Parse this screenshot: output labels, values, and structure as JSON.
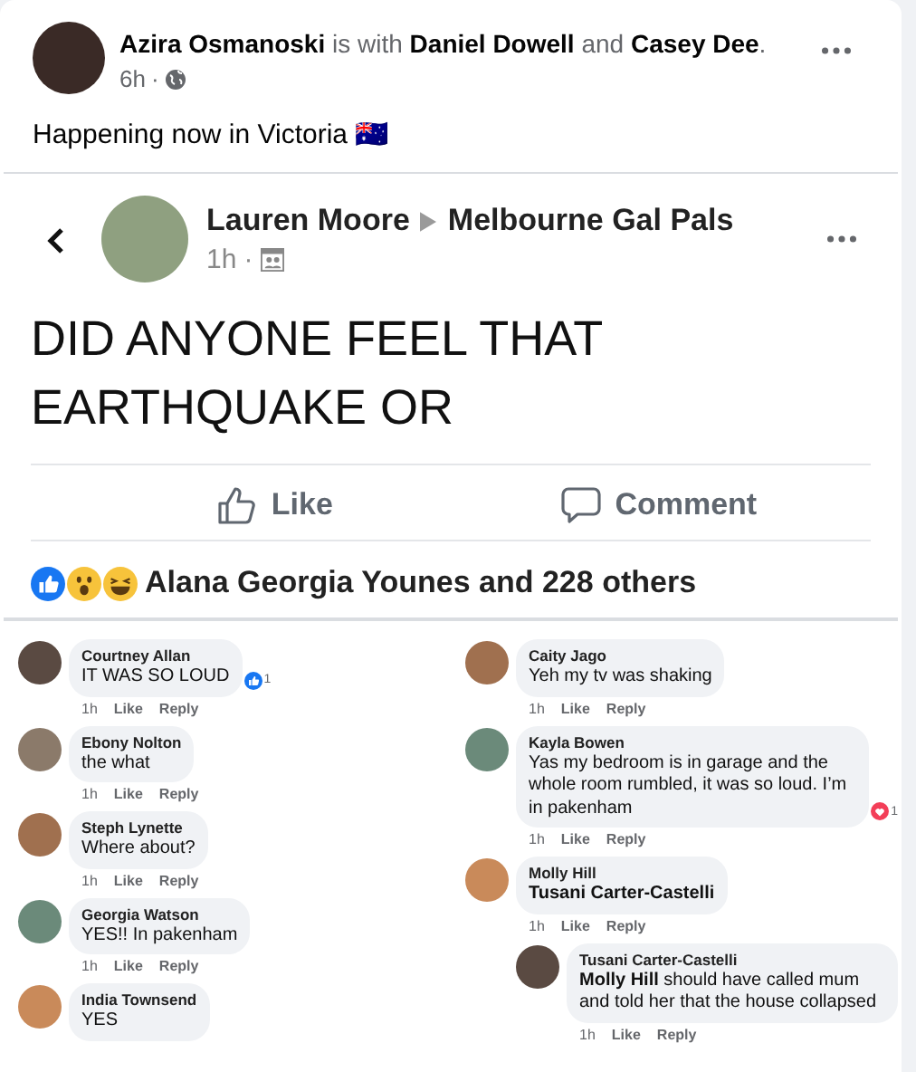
{
  "post": {
    "header": "**Azira Osmanoski** is with **Daniel Dowell** and **Casey Dee**.",
    "time": "6h",
    "separator": "·",
    "text": "Happening now in Victoria 🇦🇺"
  },
  "shared": {
    "author": "Lauren Moore",
    "group": "Melbourne Gal Pals",
    "time": "1h",
    "separator": "·",
    "text": "DID ANYONE FEEL THAT EARTHQUAKE OR",
    "actions": [
      {
        "kind": "like",
        "label": "Like"
      },
      {
        "kind": "comment",
        "label": "Comment"
      }
    ],
    "reactions": [
      {
        "kind": "like"
      },
      {
        "kind": "wow"
      },
      {
        "kind": "haha"
      }
    ],
    "reaction_summary": "Alana Georgia Younes and 228 others"
  },
  "comment_columns": [
    [
      {
        "name": "Courtney Allan",
        "text": "IT WAS SO LOUD",
        "meta": [
          "1h",
          "Like",
          "Reply"
        ],
        "reaction": {
          "kind": "like",
          "count": "1"
        }
      },
      {
        "name": "Ebony Nolton",
        "text": "the what",
        "meta": [
          "1h",
          "Like",
          "Reply"
        ]
      },
      {
        "name": "Steph Lynette",
        "text": "Where about?",
        "meta": [
          "1h",
          "Like",
          "Reply"
        ]
      },
      {
        "name": "Georgia Watson",
        "text": "YES!! In pakenham",
        "meta": [
          "1h",
          "Like",
          "Reply"
        ]
      },
      {
        "name": "India Townsend",
        "text": "YES"
      }
    ],
    [
      {
        "name": "Caity Jago",
        "text": "Yeh my tv was shaking",
        "meta": [
          "1h",
          "Like",
          "Reply"
        ]
      },
      {
        "name": "Kayla Bowen",
        "text": "Yas my bedroom is in garage and the whole room rumbled, it was so loud. I’m in pakenham",
        "meta": [
          "1h",
          "Like",
          "Reply"
        ],
        "reaction": {
          "kind": "love",
          "count": "1"
        }
      },
      {
        "name": "Molly Hill",
        "text": "**Tusani Carter-Castelli**",
        "meta": [
          "1h",
          "Like",
          "Reply"
        ],
        "children": [
          {
            "name": "Tusani Carter-Castelli",
            "text": "**Molly Hill**  should have called mum and told her that the house collapsed",
            "meta": [
              "1h",
              "Like",
              "Reply"
            ]
          }
        ]
      }
    ]
  ]
}
